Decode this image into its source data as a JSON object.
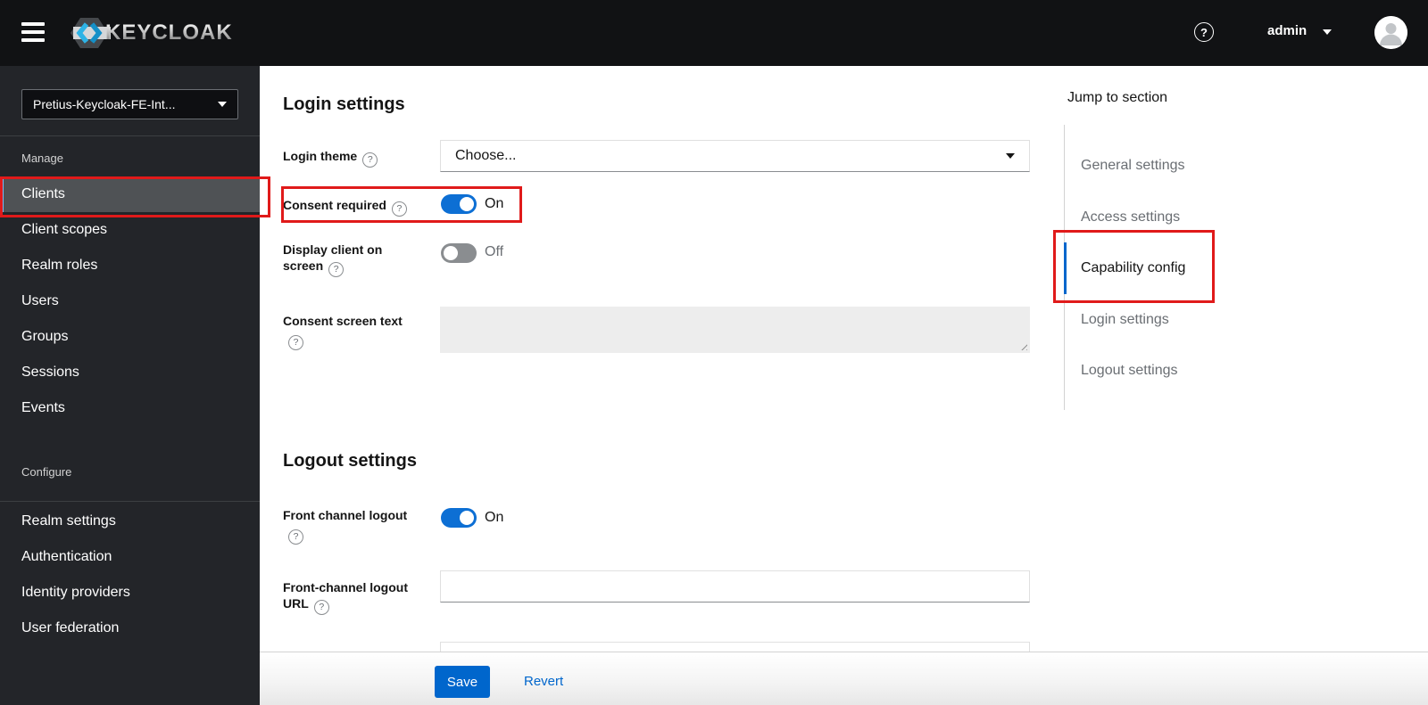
{
  "topbar": {
    "brand": "KEYCLOAK",
    "user_name": "admin"
  },
  "icons": {
    "help": "?"
  },
  "sidebar": {
    "realm_selector_value": "Pretius-Keycloak-FE-Int...",
    "current_item": "Clients",
    "sections": [
      {
        "label": "Manage",
        "items": [
          "Clients",
          "Client scopes",
          "Realm roles",
          "Users",
          "Groups",
          "Sessions",
          "Events"
        ]
      },
      {
        "label": "Configure",
        "items": [
          "Realm settings",
          "Authentication",
          "Identity providers",
          "User federation"
        ]
      }
    ]
  },
  "main": {
    "login": {
      "title": "Login settings",
      "login_theme": {
        "label": "Login theme",
        "value": "Choose..."
      },
      "consent_required": {
        "label": "Consent required",
        "state": "On"
      },
      "display_client": {
        "label_line1": "Display client on",
        "label_line2": "screen",
        "state": "Off"
      },
      "consent_screen_text": {
        "label": "Consent screen text",
        "value": ""
      }
    },
    "logout": {
      "title": "Logout settings",
      "front_channel_logout": {
        "label": "Front channel logout",
        "state": "On"
      },
      "front_channel_logout_url": {
        "label_line1": "Front-channel logout",
        "label_line2": "URL",
        "value": ""
      }
    },
    "footer": {
      "save": "Save",
      "revert": "Revert"
    }
  },
  "jump": {
    "title": "Jump to section",
    "current_item": "Capability config",
    "items": [
      "General settings",
      "Access settings",
      "Capability config",
      "Login settings",
      "Logout settings"
    ]
  },
  "colors": {
    "primary": "#0066cc",
    "toggle_on": "#0d6fd4",
    "annotation_red": "#e01a1a",
    "nav_selected_bg": "#4f5255",
    "nav_current_bar": "#73bcf7",
    "topbar_bg": "#111214",
    "sidebar_bg": "#232529"
  }
}
